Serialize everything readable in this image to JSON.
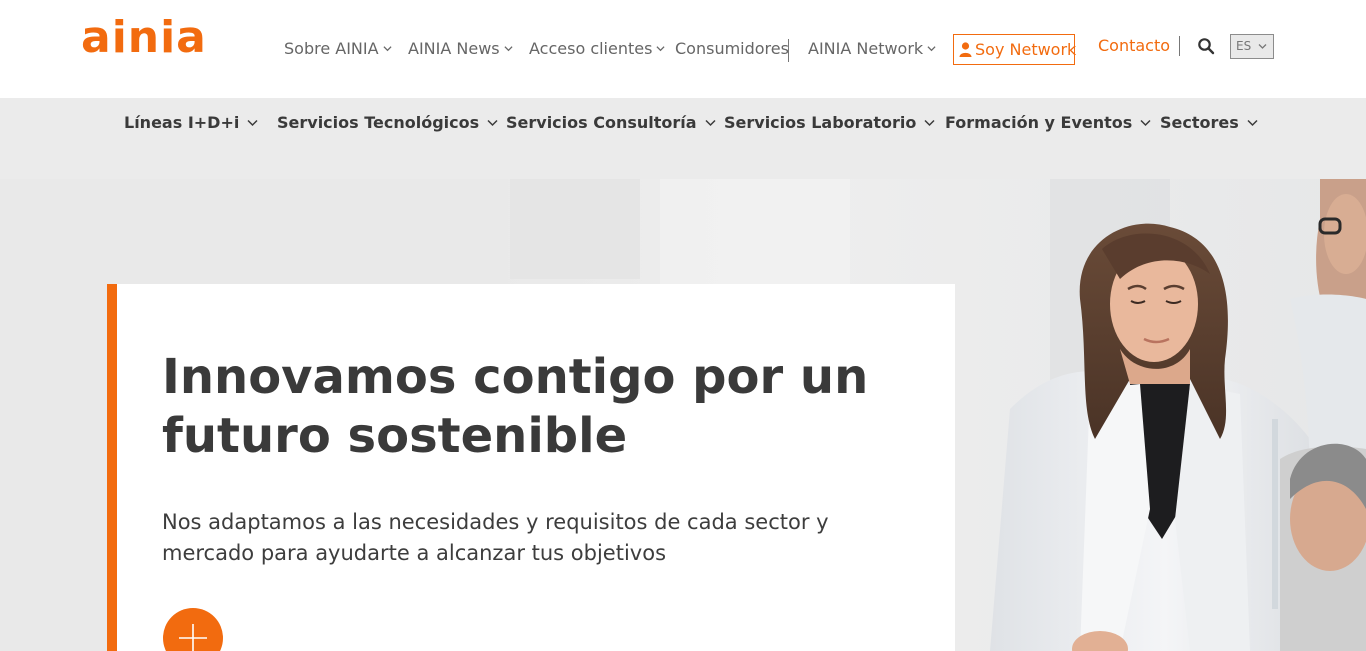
{
  "header": {
    "logo_text": "ainia",
    "nav": [
      {
        "label": "Sobre AINIA"
      },
      {
        "label": "AINIA News"
      },
      {
        "label": "Acceso clientes"
      },
      {
        "label": "Consumidores"
      },
      {
        "label": "AINIA Network"
      }
    ],
    "soy_network_label": "Soy Network",
    "contacto_label": "Contacto",
    "language": "ES"
  },
  "main_nav": {
    "items": [
      {
        "label": "Líneas I+D+i"
      },
      {
        "label": "Servicios Tecnológicos"
      },
      {
        "label": "Servicios Consultoría"
      },
      {
        "label": "Servicios Laboratorio"
      },
      {
        "label": "Formación y Eventos"
      },
      {
        "label": "Sectores"
      }
    ]
  },
  "hero": {
    "title": "Innovamos contigo por un futuro sostenible",
    "subtitle": "Nos adaptamos a las necesidades y requisitos de cada sector y mercado para ayudarte a alcanzar tus objetivos"
  },
  "colors": {
    "accent": "#f26b0f",
    "text_dark": "#3a3a3a",
    "nav_bg": "#ebebeb"
  },
  "icons": [
    "chevron-down-icon",
    "user-icon",
    "search-icon",
    "plus-icon"
  ]
}
